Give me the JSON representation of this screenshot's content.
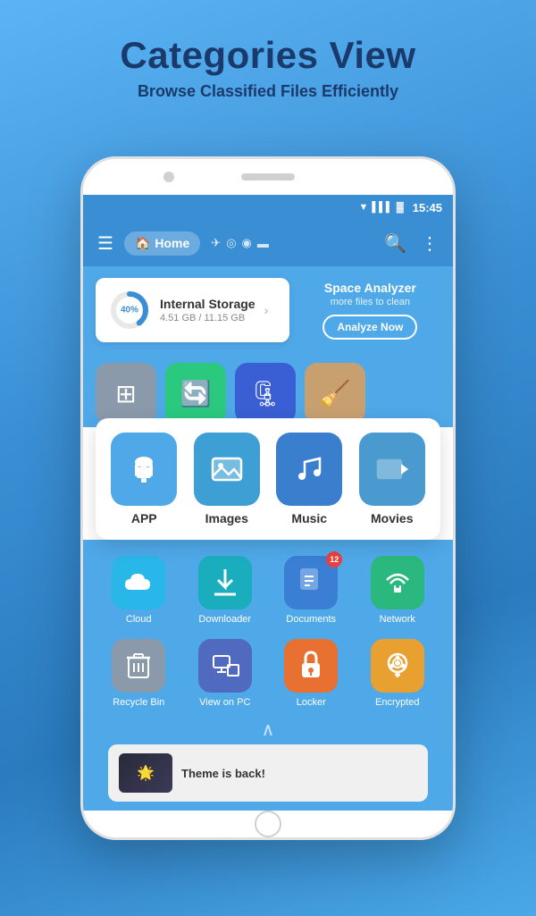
{
  "header": {
    "title": "Categories View",
    "subtitle": "Browse Classified Files Efficiently"
  },
  "statusBar": {
    "time": "15:45",
    "icons": [
      "wifi",
      "signal",
      "battery"
    ]
  },
  "appBar": {
    "homeLabel": "Home",
    "searchLabel": "search",
    "moreLabel": "more"
  },
  "storageCard": {
    "percentage": "40%",
    "name": "Internal Storage",
    "usage": "4.51 GB / 11.15 GB",
    "analyzerTitle": "Space Analyzer",
    "analyzerSub": "more files to clean",
    "analyzerBtn": "Analyze Now"
  },
  "popupGrid": {
    "items": [
      {
        "label": "APP",
        "color": "app-color",
        "icon": "🤖"
      },
      {
        "label": "Images",
        "color": "images-color",
        "icon": "🖼"
      },
      {
        "label": "Music",
        "color": "music-color",
        "icon": "🎵"
      },
      {
        "label": "Movies",
        "color": "movies-color",
        "icon": "🎬"
      }
    ]
  },
  "row1": [
    {
      "label": "Cloud",
      "color": "sky",
      "icon": "☁",
      "badge": null
    },
    {
      "label": "Downloader",
      "color": "teal-d",
      "icon": "⬇",
      "badge": null
    },
    {
      "label": "Documents",
      "color": "blue-d",
      "icon": "📄",
      "badge": "12"
    },
    {
      "label": "Network",
      "color": "green-d",
      "icon": "📡",
      "badge": null
    }
  ],
  "row2": [
    {
      "label": "Recycle Bin",
      "color": "gray-d",
      "icon": "🗑",
      "badge": null
    },
    {
      "label": "View on PC",
      "color": "indigo",
      "icon": "🖥",
      "badge": null
    },
    {
      "label": "Locker",
      "color": "orange-d",
      "icon": "🔒",
      "badge": null
    },
    {
      "label": "Encrypted",
      "color": "gold",
      "icon": "🔐",
      "badge": null
    }
  ],
  "news": {
    "headline": "Theme is back!"
  }
}
